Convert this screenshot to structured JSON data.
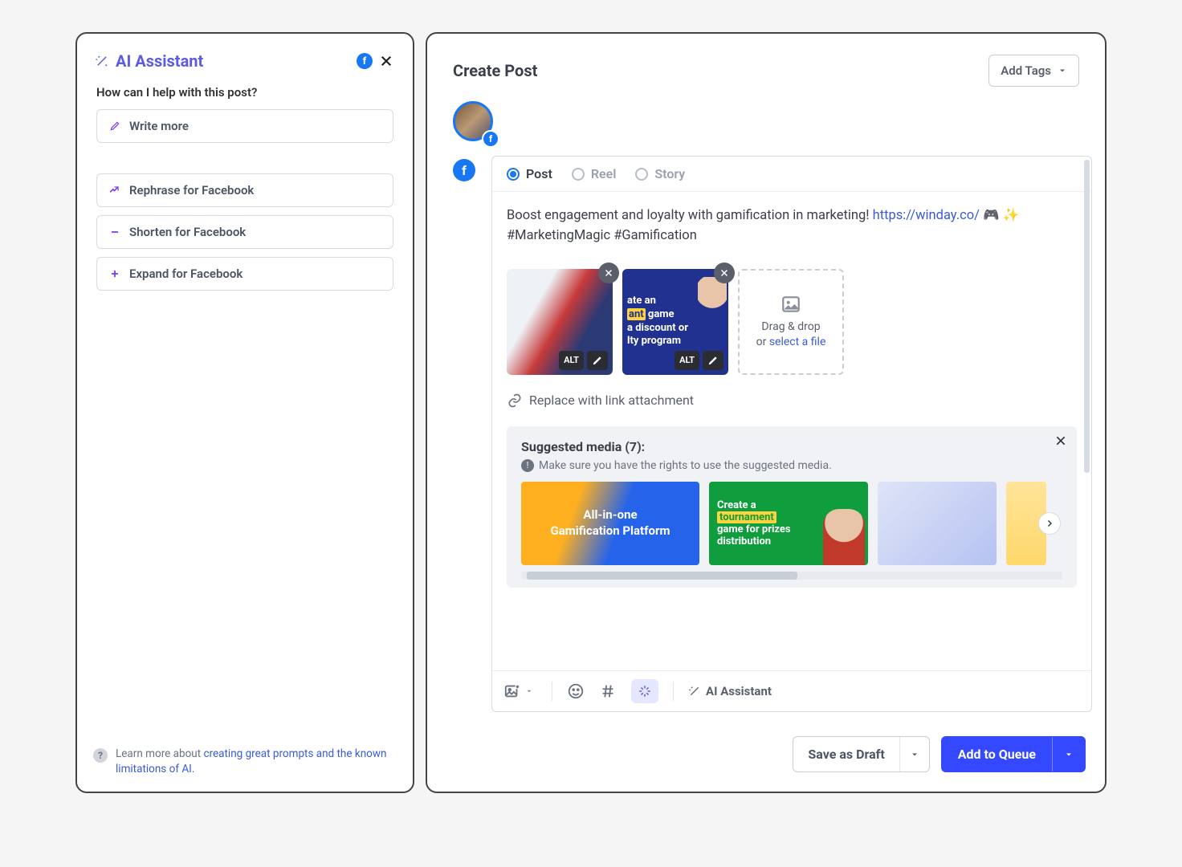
{
  "ai": {
    "title": "AI Assistant",
    "question": "How can I help with this post?",
    "options": [
      {
        "icon": "pencil",
        "label": "Write more"
      },
      {
        "icon": "rewrite",
        "label": "Rephrase for Facebook"
      },
      {
        "icon": "minus",
        "label": "Shorten for Facebook"
      },
      {
        "icon": "plus",
        "label": "Expand for Facebook"
      }
    ],
    "footer_pre": "Learn more about ",
    "footer_link": "creating great prompts and the known limitations of AI."
  },
  "cp": {
    "title": "Create Post",
    "add_tags": "Add Tags",
    "tabs": {
      "post": "Post",
      "reel": "Reel",
      "story": "Story"
    },
    "post": {
      "text_pre": "Boost engagement and loyalty with gamification in marketing! ",
      "link": "https://winday.co/",
      "emoji": "  🎮 ✨",
      "text_post": "#MarketingMagic #Gamification"
    },
    "media": {
      "tile2_line1_pre": "ate an",
      "tile2_hl": "ant",
      "tile2_line2": " game",
      "tile2_line3": "a discount or",
      "tile2_line4": "lty program",
      "alt_label": "ALT",
      "drop_label": "Drag & drop",
      "drop_or": "or ",
      "drop_link": "select a file"
    },
    "replace_link": "Replace with link attachment",
    "suggest": {
      "title_pre": "Suggested media (",
      "count": "7",
      "title_post": "):",
      "hint": "Make sure you have the rights to use the suggested media.",
      "sg1_line1": "All-in-one",
      "sg1_line2": "Gamification Platform",
      "sg2_l1": "Create a",
      "sg2_hl": "tournament",
      "sg2_l3": "game for prizes",
      "sg2_l4": "distribution"
    },
    "ai_button": "AI Assistant",
    "save_draft": "Save as Draft",
    "add_queue": "Add to Queue"
  }
}
